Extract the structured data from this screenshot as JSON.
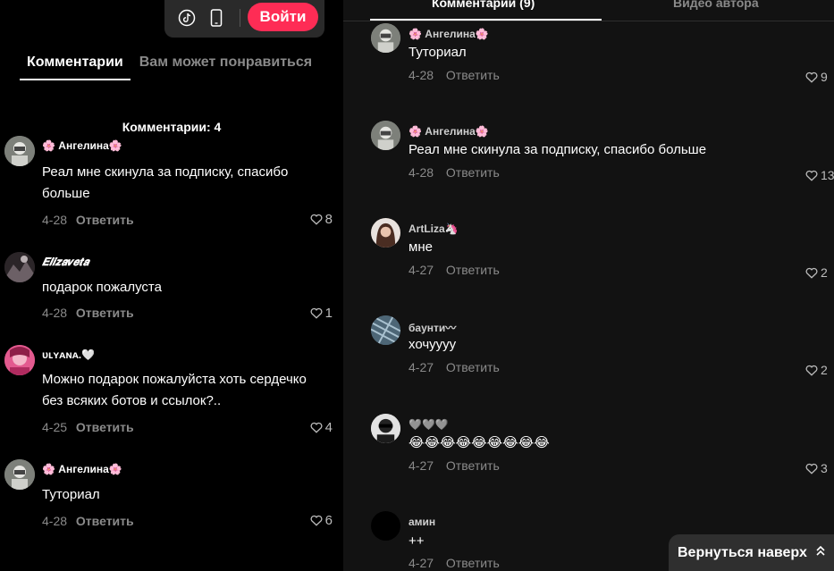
{
  "left_panel": {
    "top_bar": {
      "icons": [
        "tiktok-icon",
        "mobile-icon"
      ],
      "login_label": "Войти"
    },
    "tabs": [
      {
        "label": "Комментарии",
        "active": true
      },
      {
        "label": "Вам может понравиться",
        "active": false
      }
    ],
    "comments_count_label": "Комментарии: 4",
    "comments": [
      {
        "name": "🌸 Ангелина🌸",
        "text": "Реал мне скинула за подписку, спасибо больше",
        "date": "4-28",
        "reply": "Ответить",
        "likes": "8",
        "avatar_color": "#8a8c88"
      },
      {
        "name": "𝑬𝒍𝒊𝒛𝒂𝒗𝒆𝒕𝒂",
        "text": "подарок пожалуста",
        "date": "4-28",
        "reply": "Ответить",
        "likes": "1",
        "avatar_color": "#3a3236"
      },
      {
        "name": "ᴜʟʏᴀɴᴀ.🤍",
        "text": "Можно подарок пожалуйста хоть сердечко без всяких ботов и ссылок?..",
        "date": "4-25",
        "reply": "Ответить",
        "likes": "4",
        "avatar_color": "#d0457a"
      },
      {
        "name": "🌸 Ангелина🌸",
        "text": "Туториал",
        "date": "4-28",
        "reply": "Ответить",
        "likes": "6",
        "avatar_color": "#8a8c88"
      }
    ]
  },
  "right_panel": {
    "tabs": [
      {
        "label": "Комментарии (9)",
        "active": true
      },
      {
        "label": "Видео автора",
        "active": false
      }
    ],
    "comments": [
      {
        "name": "🌸 Ангелина🌸",
        "text": "Туториал",
        "date": "4-28",
        "reply": "Ответить",
        "likes": "9",
        "avatar_color": "#8a8c88"
      },
      {
        "name": "🌸 Ангелина🌸",
        "text": "Реал мне скинула за подписку, спасибо больше",
        "date": "4-28",
        "reply": "Ответить",
        "likes": "13",
        "avatar_color": "#8a8c88"
      },
      {
        "name": "ArtLiza🦄",
        "text": "мне",
        "date": "4-27",
        "reply": "Ответить",
        "likes": "2",
        "avatar_color": "#6b4a3c"
      },
      {
        "name": "баунти〰",
        "text": "хочуууу",
        "date": "4-27",
        "reply": "Ответить",
        "likes": "2",
        "avatar_color": "#5a7180"
      },
      {
        "name": "🩶🩶🩶",
        "text": "😂😂😂😂😂😂😂😂😂",
        "date": "4-27",
        "reply": "Ответить",
        "likes": "3",
        "avatar_color": "#d8d8d8"
      },
      {
        "name": "амин",
        "text": "++",
        "date": "4-27",
        "reply": "Ответить",
        "likes": "",
        "avatar_color": "#000000"
      }
    ],
    "back_to_top_label": "Вернуться наверх"
  },
  "colors": {
    "accent": "#fe2c55",
    "left_bg": "#000000",
    "right_bg": "#121212",
    "muted": "#8a8a8a"
  }
}
